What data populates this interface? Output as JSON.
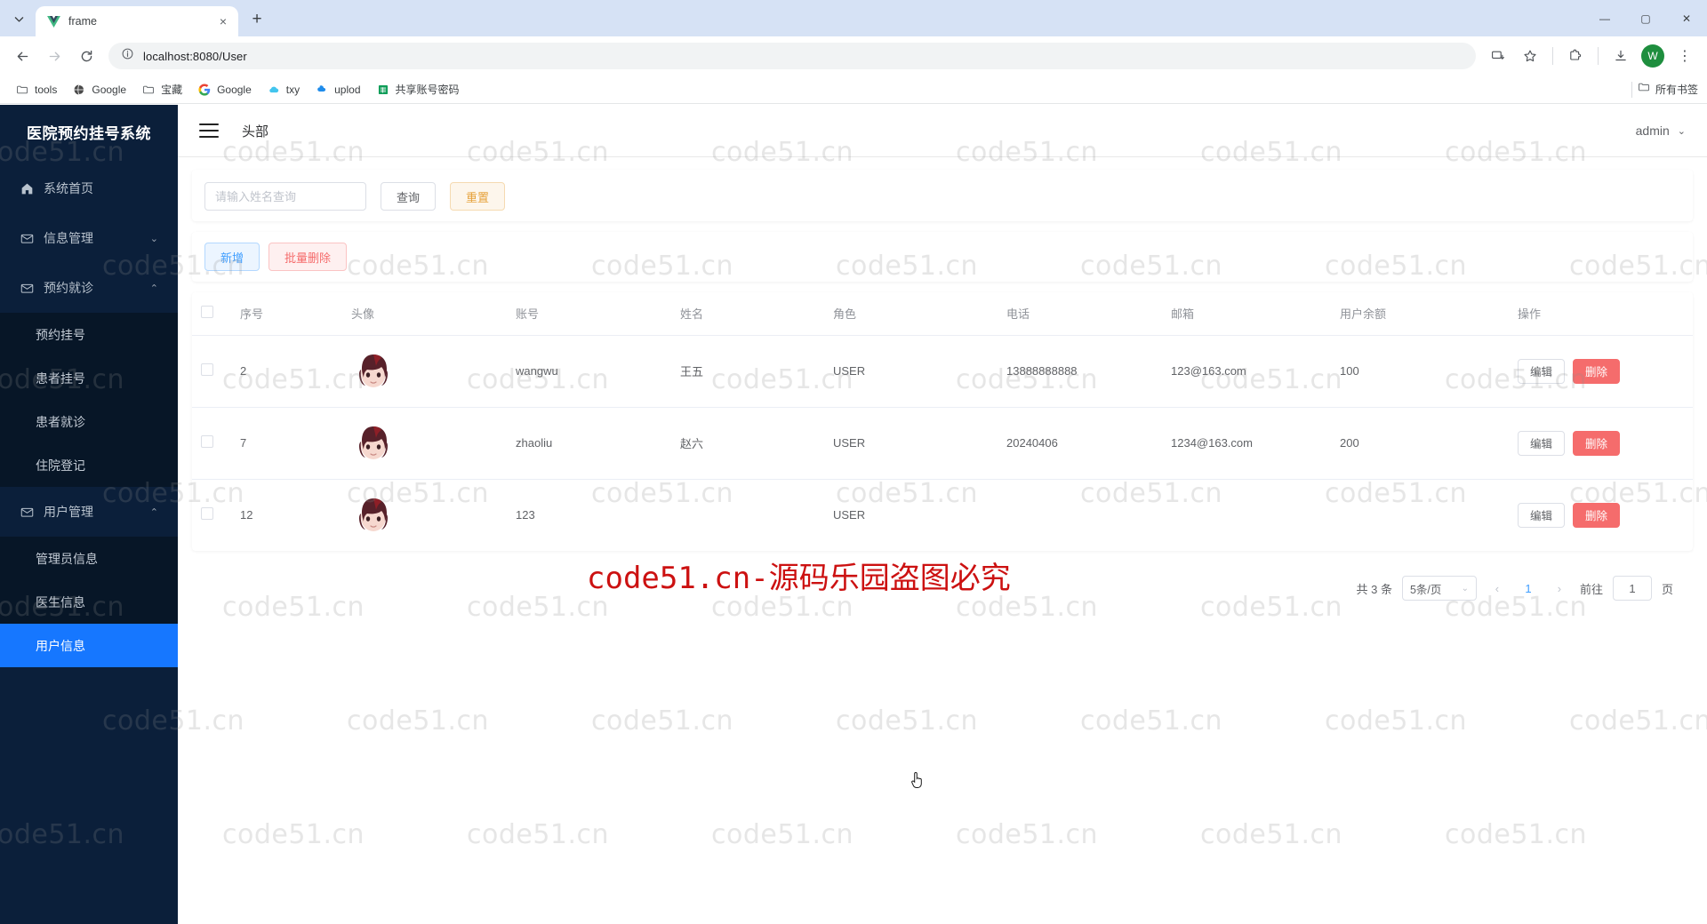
{
  "browser": {
    "tab": {
      "title": "frame",
      "favicon": "vue-logo-icon",
      "close_label": "×"
    },
    "new_tab_label": "+",
    "window_controls": {
      "minimize": "—",
      "maximize": "▢",
      "close": "✕"
    },
    "nav": {
      "back": "←",
      "forward": "→",
      "reload": "⟳",
      "site_info": "ⓘ"
    },
    "url": "localhost:8080/User",
    "right_icons": [
      "install-icon",
      "bookmark-star-icon",
      "extensions-icon",
      "downloads-icon"
    ],
    "profile_initial": "W",
    "menu_label": "⋮",
    "bookmarks": [
      {
        "label": "tools",
        "icon": "folder-icon"
      },
      {
        "label": "Google",
        "icon": "globe-icon"
      },
      {
        "label": "宝藏",
        "icon": "folder-icon"
      },
      {
        "label": "Google",
        "icon": "google-g-icon"
      },
      {
        "label": "txy",
        "icon": "cloud-icon"
      },
      {
        "label": "uplod",
        "icon": "upload-cloud-icon"
      },
      {
        "label": "共享账号密码",
        "icon": "sheets-icon"
      }
    ],
    "all_bookmarks_label": "所有书签"
  },
  "sidebar": {
    "brand": "医院预约挂号系统",
    "items": [
      {
        "label": "系统首页",
        "icon": "home-icon",
        "arrow": ""
      },
      {
        "label": "信息管理",
        "icon": "mail-icon",
        "arrow": "⌄"
      },
      {
        "label": "预约就诊",
        "icon": "mail-icon",
        "arrow": "⌃"
      }
    ],
    "group1": [
      {
        "label": "预约挂号",
        "active": false
      },
      {
        "label": "患者挂号",
        "active": false
      },
      {
        "label": "患者就诊",
        "active": false
      },
      {
        "label": "住院登记",
        "active": false
      }
    ],
    "user_group": {
      "label": "用户管理",
      "icon": "mail-icon",
      "arrow": "⌃"
    },
    "group2": [
      {
        "label": "管理员信息",
        "active": false
      },
      {
        "label": "医生信息",
        "active": false
      },
      {
        "label": "用户信息",
        "active": true
      }
    ]
  },
  "header": {
    "menu_toggle": "hamburger-icon",
    "title": "头部",
    "user": "admin",
    "chevron": "⌄"
  },
  "search": {
    "placeholder": "请输入姓名查询",
    "value": "",
    "query_label": "查询",
    "reset_label": "重置"
  },
  "toolbar": {
    "add_label": "新增",
    "batch_delete_label": "批量删除"
  },
  "table": {
    "columns": [
      "序号",
      "头像",
      "账号",
      "姓名",
      "角色",
      "电话",
      "邮箱",
      "用户余额",
      "操作"
    ],
    "edit_label": "编辑",
    "delete_label": "删除",
    "rows": [
      {
        "id": "2",
        "avatar": "user-avatar",
        "account": "wangwu",
        "name": "王五",
        "role": "USER",
        "phone": "13888888888",
        "email": "123@163.com",
        "balance": "100"
      },
      {
        "id": "7",
        "avatar": "user-avatar",
        "account": "zhaoliu",
        "name": "赵六",
        "role": "USER",
        "phone": "20240406",
        "email": "1234@163.com",
        "balance": "200"
      },
      {
        "id": "12",
        "avatar": "user-avatar",
        "account": "123",
        "name": "",
        "role": "USER",
        "phone": "",
        "email": "",
        "balance": ""
      }
    ]
  },
  "pagination": {
    "total_label": "共 3 条",
    "page_size": "5条/页",
    "prev": "‹",
    "next": "›",
    "current_page": "1",
    "goto_label": "前往",
    "goto_value": "1",
    "page_unit": "页"
  },
  "watermark": {
    "tile_text": "code51.cn",
    "big_text": "code51.cn-源码乐园盗图必究",
    "big_color": "#cc1111"
  },
  "colors": {
    "sidebar_bg": "#0b1f3a",
    "sidebar_sub_bg": "#071627",
    "active_blue": "#1677ff",
    "primary": "#409eff",
    "danger": "#f56c6c",
    "warning": "#e6a23c"
  }
}
